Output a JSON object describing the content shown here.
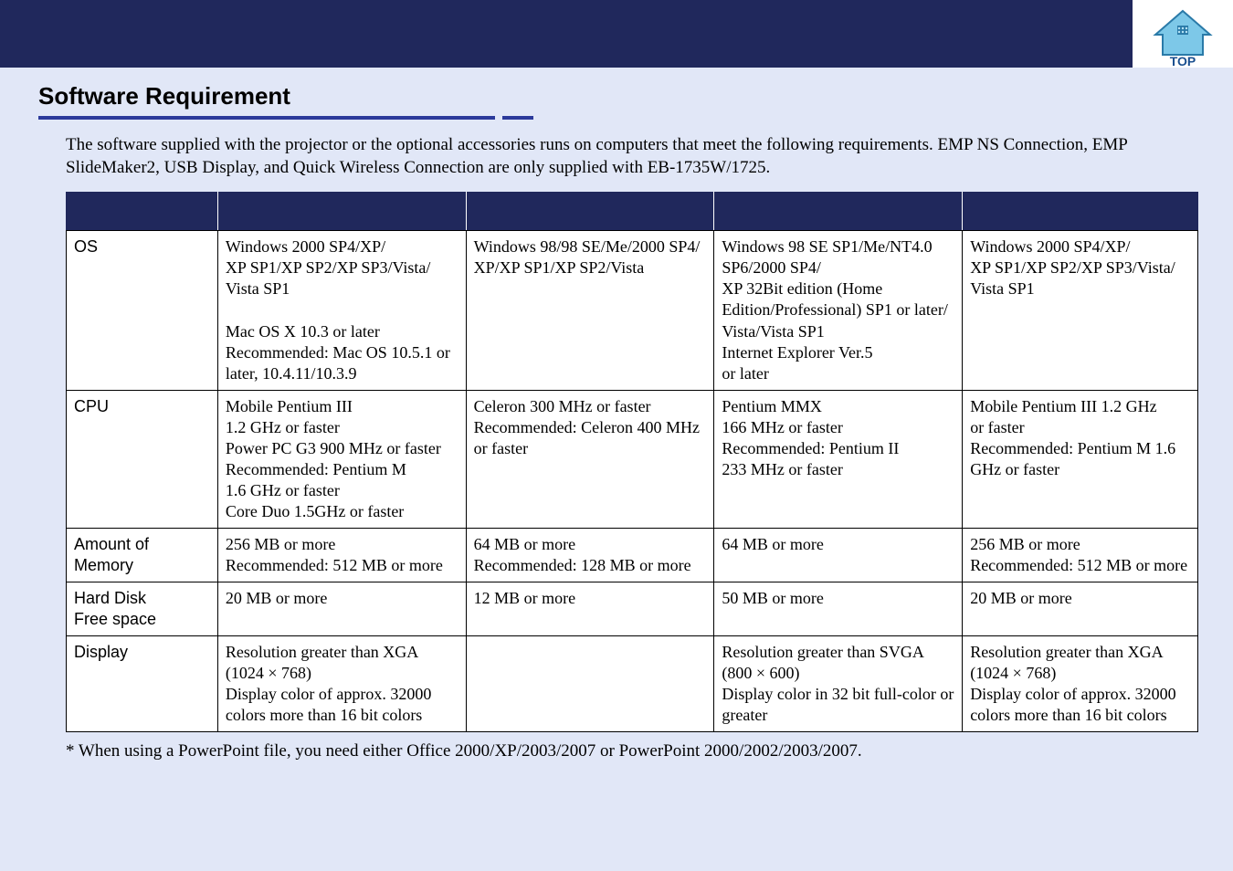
{
  "header": {
    "home_icon_name": "home-icon",
    "top_label": "TOP"
  },
  "section": {
    "title": "Software Requirement",
    "intro": "The software supplied with the projector or the optional accessories runs on computers that meet the following requirements. EMP NS Connection, EMP SlideMaker2, USB Display, and Quick Wireless Connection are only supplied with EB-1735W/1725."
  },
  "table": {
    "rows": [
      {
        "label": "OS",
        "cells": [
          "Windows 2000 SP4/XP/\nXP SP1/XP SP2/XP SP3/Vista/\nVista SP1\n\nMac OS X 10.3 or later\nRecommended: Mac OS 10.5.1 or later, 10.4.11/10.3.9",
          "Windows 98/98 SE/Me/2000 SP4/\nXP/XP SP1/XP SP2/Vista",
          "Windows 98 SE  SP1/Me/NT4.0 SP6/2000 SP4/\nXP 32Bit edition (Home Edition/Professional) SP1 or later/\nVista/Vista SP1\nInternet Explorer Ver.5\nor later",
          "Windows 2000 SP4/XP/\nXP SP1/XP SP2/XP SP3/Vista/\nVista SP1"
        ]
      },
      {
        "label": "CPU",
        "cells": [
          "Mobile Pentium III\n1.2 GHz or faster\nPower PC G3 900 MHz or faster\nRecommended: Pentium M\n1.6 GHz or faster\nCore Duo 1.5GHz or faster",
          "Celeron 300 MHz or faster\nRecommended: Celeron 400 MHz or faster",
          "Pentium MMX\n166 MHz or faster\nRecommended: Pentium II\n233 MHz or faster",
          "Mobile Pentium III 1.2 GHz\nor faster\nRecommended: Pentium M 1.6 GHz or faster"
        ]
      },
      {
        "label": "Amount of Memory",
        "cells": [
          "256 MB or more\nRecommended: 512 MB or more",
          "64 MB or more\nRecommended: 128 MB or more",
          "64 MB or more",
          "256 MB or more\nRecommended: 512 MB or more"
        ]
      },
      {
        "label": "Hard Disk\nFree space",
        "cells": [
          "20 MB or more",
          "12 MB or more",
          "50 MB or more",
          "20 MB or more"
        ]
      },
      {
        "label": "Display",
        "cells": [
          "Resolution greater than XGA (1024 × 768)\nDisplay color of approx. 32000 colors more than 16 bit colors",
          "",
          "Resolution greater than SVGA (800 × 600)\nDisplay color in 32 bit full-color or greater",
          "Resolution greater than XGA (1024 × 768)\nDisplay color of approx. 32000 colors more than 16 bit colors"
        ]
      }
    ]
  },
  "footnote": "* When using a PowerPoint file, you need either Office 2000/XP/2003/2007 or PowerPoint 2000/2002/2003/2007."
}
